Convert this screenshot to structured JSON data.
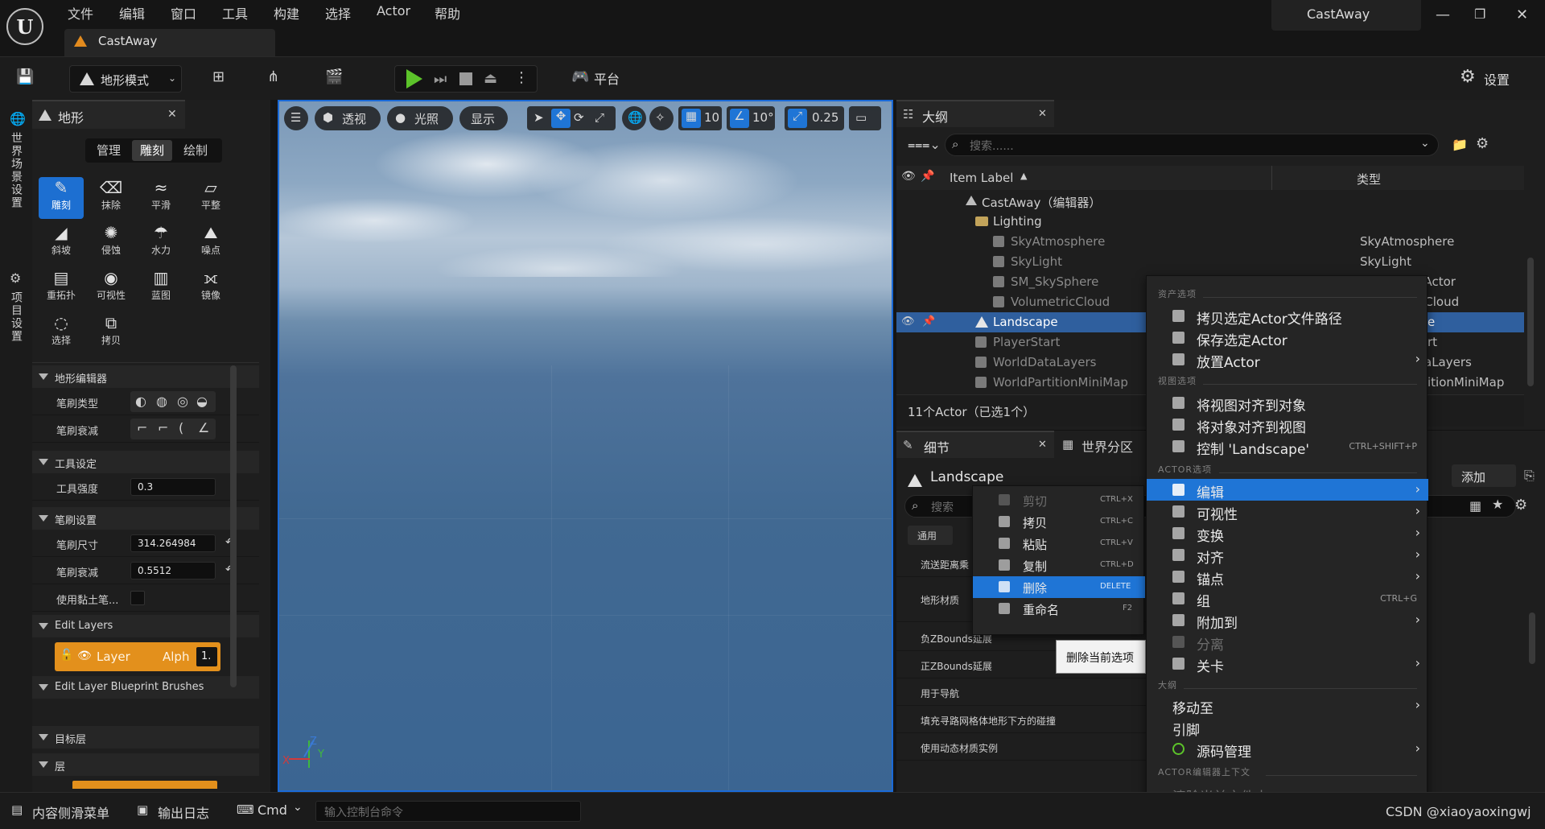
{
  "app": {
    "logo_text": "U",
    "menu": [
      "文件",
      "编辑",
      "窗口",
      "工具",
      "构建",
      "选择",
      "Actor",
      "帮助"
    ],
    "doc_tab": "CastAway",
    "window_title": "CastAway"
  },
  "toolbar": {
    "mode": "地形模式",
    "platform": "平台",
    "settings": "设置"
  },
  "left_strip": {
    "world_settings": "世界场景设置",
    "project_settings": "项目设置"
  },
  "landscape": {
    "tab": "地形",
    "modes": [
      "管理",
      "雕刻",
      "绘制"
    ],
    "active_mode": "雕刻",
    "tools": [
      {
        "label": "雕刻",
        "icon": "brush-icon",
        "active": true
      },
      {
        "label": "抹除",
        "icon": "eraser-icon"
      },
      {
        "label": "平滑",
        "icon": "smooth-icon"
      },
      {
        "label": "平整",
        "icon": "flatten-icon"
      },
      {
        "label": "斜坡",
        "icon": "ramp-icon"
      },
      {
        "label": "侵蚀",
        "icon": "erosion-icon"
      },
      {
        "label": "水力",
        "icon": "hydro-icon"
      },
      {
        "label": "噪点",
        "icon": "noise-icon"
      },
      {
        "label": "重拓扑",
        "icon": "retopo-icon"
      },
      {
        "label": "可视性",
        "icon": "visibility-icon"
      },
      {
        "label": "蓝图",
        "icon": "blueprint-icon"
      },
      {
        "label": "镜像",
        "icon": "mirror-icon"
      },
      {
        "label": "选择",
        "icon": "select-icon"
      },
      {
        "label": "拷贝",
        "icon": "copy-icon"
      }
    ],
    "sections": {
      "editor": "地形编辑器",
      "brush_type": "笔刷类型",
      "brush_falloff": "笔刷衰减",
      "tool_settings": "工具设定",
      "tool_strength": "工具强度",
      "tool_strength_value": "0.3",
      "brush_settings": "笔刷设置",
      "brush_size": "笔刷尺寸",
      "brush_size_value": "314.264984",
      "brush_falloff2": "笔刷衰减",
      "brush_falloff_value": "0.5512",
      "use_clay": "使用黏土笔...",
      "edit_layers": "Edit Layers",
      "layer_name": "Layer",
      "layer_alpha": "Alph",
      "layer_index": "1.",
      "edit_layer_bp": "Edit Layer Blueprint Brushes",
      "target_layers": "目标层",
      "layers": "层"
    }
  },
  "viewport": {
    "perspective": "透视",
    "lighting": "光照",
    "show": "显示",
    "grid_value": "10",
    "angle_value": "10°",
    "scale_value": "0.25",
    "axis_y": "Y",
    "axis_z": "Z",
    "axis_x": "X"
  },
  "outliner": {
    "tab": "大纲",
    "search_placeholder": "搜索......",
    "col_label": "Item Label",
    "col_type": "类型",
    "rows": [
      {
        "label": "CastAway（编辑器）",
        "type": ""
      },
      {
        "label": "Lighting",
        "type": ""
      },
      {
        "label": "SkyAtmosphere",
        "type": "SkyAtmosphere"
      },
      {
        "label": "SkyLight",
        "type": "SkyLight"
      },
      {
        "label": "SM_SkySphere",
        "type": "hActor"
      },
      {
        "label": "VolumetricCloud",
        "type": "cCloud"
      },
      {
        "label": "Landscape",
        "type": "e"
      },
      {
        "label": "PlayerStart",
        "type": "rt"
      },
      {
        "label": "WorldDataLayers",
        "type": "aLayers"
      },
      {
        "label": "WorldPartitionMiniMap",
        "type": "itionMiniMap"
      }
    ],
    "status": "11个Actor（已选1个）"
  },
  "details": {
    "tab": "细节",
    "tab2": "世界分区",
    "object": "Landscape",
    "add_btn": "添加",
    "search_placeholder": "搜索",
    "filter_general": "通用",
    "rows": [
      "流送距离乘",
      "地形材质",
      "负ZBounds延展",
      "正ZBounds延展",
      "用于导航",
      "填充寻路网格体地形下方的碰撞",
      "使用动态材质实例"
    ]
  },
  "ctx_small": {
    "items": [
      {
        "label": "剪切",
        "key": "CTRL+X",
        "disabled": true
      },
      {
        "label": "拷贝",
        "key": "CTRL+C"
      },
      {
        "label": "粘贴",
        "key": "CTRL+V"
      },
      {
        "label": "复制",
        "key": "CTRL+D"
      },
      {
        "label": "删除",
        "key": "DELETE",
        "highlight": true
      },
      {
        "label": "重命名",
        "key": "F2"
      }
    ],
    "tooltip": "删除当前选项"
  },
  "ctx_big": {
    "sec_asset": "资产选项",
    "sec_view": "视图选项",
    "sec_actor": "ACTOR选项",
    "sec_outline": "大纲",
    "sec_context": "ACTOR编辑器上下文",
    "items": {
      "copy_path": "拷贝选定Actor文件路径",
      "save_actor": "保存选定Actor",
      "place_actor": "放置Actor",
      "view_to_obj": "将视图对齐到对象",
      "obj_to_view": "将对象对齐到视图",
      "pilot": "控制 'Landscape'",
      "pilot_key": "CTRL+SHIFT+P",
      "edit": "编辑",
      "visibility": "可视性",
      "transform": "变换",
      "align": "对齐",
      "pivot": "锚点",
      "group": "组",
      "group_key": "CTRL+G",
      "attach": "附加到",
      "detach": "分离",
      "level": "关卡",
      "move_to": "移动至",
      "refs": "引脚",
      "source_control": "源码管理",
      "clear_folder": "清除当前文件夹"
    }
  },
  "bottom": {
    "content_drawer": "内容侧滑菜单",
    "output_log": "输出日志",
    "cmd": "Cmd",
    "console_placeholder": "输入控制台命令",
    "watermark": "CSDN @xiaoyaoxingwj"
  },
  "colors": {
    "accent": "#1f75d6",
    "layer": "#e3901c",
    "play": "#5cc32a"
  }
}
